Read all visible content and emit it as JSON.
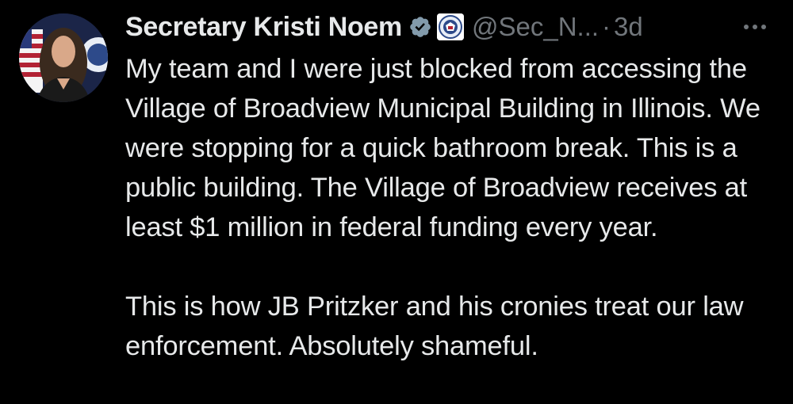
{
  "post": {
    "author": {
      "display_name": "Secretary Kristi Noem",
      "handle": "@Sec_N...",
      "verified_icon": "verified-badge-icon",
      "affiliate_icon": "dhs-seal-icon",
      "avatar_icon": "profile-avatar"
    },
    "separator": "·",
    "time": "3d",
    "more_icon": "more-options-icon",
    "paragraphs": [
      "My team and I were just blocked from accessing the Village of Broadview Municipal Building in Illinois. We were stopping for a quick bathroom break. This is a public building. The Village of Broadview receives at least $1 million in federal funding every year.",
      "This is how JB Pritzker and his cronies treat our law enforcement. Absolutely shameful."
    ]
  },
  "colors": {
    "background": "#000000",
    "text": "#e7e9ea",
    "secondary": "#71767b",
    "verified": "#829aab"
  }
}
